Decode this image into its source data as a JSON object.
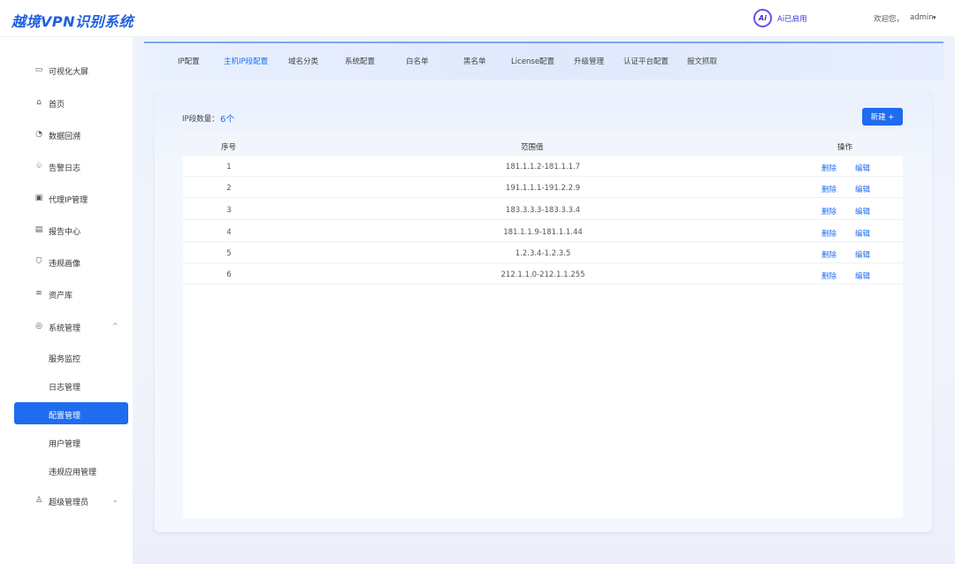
{
  "header": {
    "brand": "越境VPN识别系统",
    "ai_badge": "Ai",
    "ai_status": "Ai已启用",
    "welcome": "欢迎您，",
    "user": "admin",
    "caret": "▾"
  },
  "sidebar": {
    "items": [
      {
        "label": "可视化大屏",
        "icon": "monitor-icon",
        "glyph": "▭"
      },
      {
        "label": "首页",
        "icon": "home-icon",
        "glyph": "⌂"
      },
      {
        "label": "数据回溯",
        "icon": "pie-chart-icon",
        "glyph": "◔"
      },
      {
        "label": "告警日志",
        "icon": "alarm-icon",
        "glyph": "♧"
      },
      {
        "label": "代理IP管理",
        "icon": "screen-icon",
        "glyph": "▣"
      },
      {
        "label": "报告中心",
        "icon": "report-icon",
        "glyph": "▤"
      },
      {
        "label": "违规画像",
        "icon": "shield-icon",
        "glyph": "⛉"
      },
      {
        "label": "资产库",
        "icon": "layers-icon",
        "glyph": "≋"
      },
      {
        "label": "系统管理",
        "icon": "gear-icon",
        "glyph": "◎",
        "arrow": "^"
      }
    ],
    "sub_items": [
      {
        "label": "服务监控",
        "active": false
      },
      {
        "label": "日志管理",
        "active": false
      },
      {
        "label": "配置管理",
        "active": true
      },
      {
        "label": "用户管理",
        "active": false
      },
      {
        "label": "违规应用管理",
        "active": false
      }
    ],
    "last_item": {
      "label": "超级管理员",
      "icon": "user-admin-icon",
      "glyph": "♙",
      "arrow": "⌄"
    }
  },
  "tabs": [
    {
      "label": "IP配置",
      "active": false
    },
    {
      "label": "主机IP段配置",
      "active": true
    },
    {
      "label": "域名分类",
      "active": false
    },
    {
      "label": "系统配置",
      "active": false
    },
    {
      "label": "白名单",
      "active": false
    },
    {
      "label": "黑名单",
      "active": false
    },
    {
      "label": "License配置",
      "active": false
    },
    {
      "label": "升级管理",
      "active": false
    },
    {
      "label": "认证平台配置",
      "active": false
    },
    {
      "label": "报文抓取",
      "active": false
    }
  ],
  "content": {
    "count_label": "IP段数量：",
    "count_value": "6个",
    "new_button": "新建 +",
    "columns": {
      "index": "序号",
      "range": "范围值",
      "actions": "操作"
    },
    "rows": [
      {
        "index": "1",
        "range": "181.1.1.2-181.1.1.7",
        "delete": "删除",
        "edit": "编辑"
      },
      {
        "index": "2",
        "range": "191.1.1.1-191.2.2.9",
        "delete": "删除",
        "edit": "编辑"
      },
      {
        "index": "3",
        "range": "183.3.3.3-183.3.3.4",
        "delete": "删除",
        "edit": "编辑"
      },
      {
        "index": "4",
        "range": "181.1.1.9-181.1.1.44",
        "delete": "删除",
        "edit": "编辑"
      },
      {
        "index": "5",
        "range": "1.2.3.4-1.2.3.5",
        "delete": "删除",
        "edit": "编辑"
      },
      {
        "index": "6",
        "range": "212.1.1.0-212.1.1.255",
        "delete": "删除",
        "edit": "编辑"
      }
    ]
  }
}
